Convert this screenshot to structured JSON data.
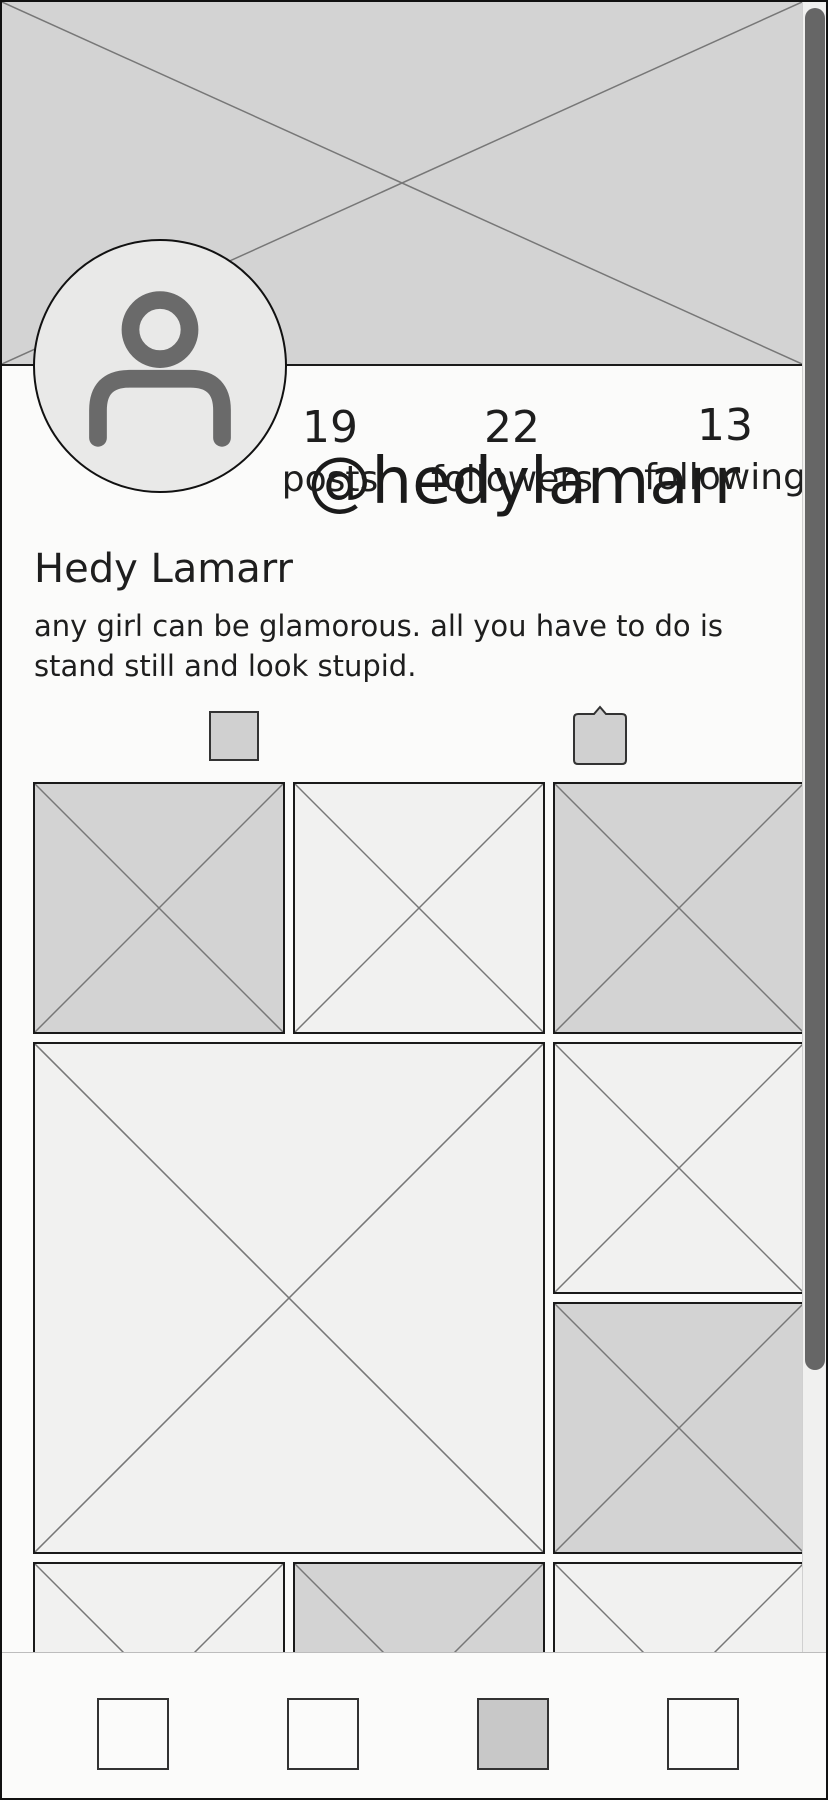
{
  "profile": {
    "handle": "@hedylamarr",
    "display_name": "Hedy Lamarr",
    "bio": "any girl can be glamorous. all you have to do is stand still and look stupid."
  },
  "stats": [
    {
      "value": "19",
      "label": "posts"
    },
    {
      "value": "22",
      "label": "followers"
    },
    {
      "value": "13",
      "label": "following"
    }
  ],
  "icons": {
    "avatar": "user-icon",
    "grid_toggle": "grid-view-icon",
    "tagged_toggle": "tagged-icon"
  },
  "bottom_nav": {
    "active_index": 2,
    "items": [
      "home-icon",
      "search-icon",
      "profile-icon",
      "settings-icon"
    ]
  },
  "colors": {
    "placeholder_fill": "#d3d3d3",
    "placeholder_light": "#f1f1f0",
    "background": "#fbfbfa",
    "icon_gray": "#6a6a6a"
  }
}
